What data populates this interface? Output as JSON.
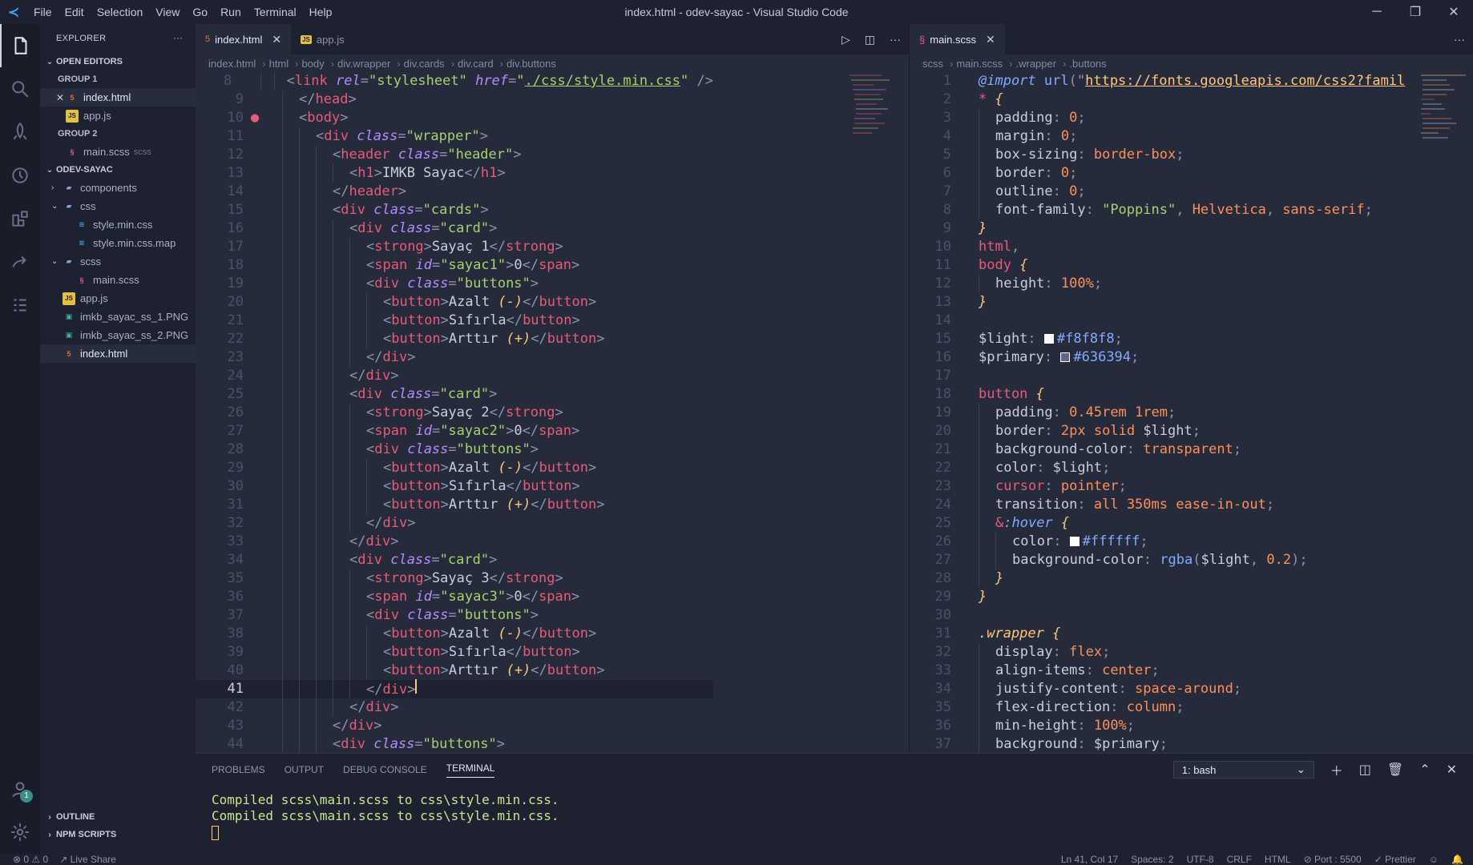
{
  "titlebar": {
    "title": "index.html - odev-sayac - Visual Studio Code",
    "menu": [
      "File",
      "Edit",
      "Selection",
      "View",
      "Go",
      "Run",
      "Terminal",
      "Help"
    ]
  },
  "activity": {
    "icons": [
      "files-icon",
      "search-icon",
      "rocket-icon",
      "history-icon",
      "extensions-icon",
      "live-share-icon",
      "list-icon"
    ],
    "account_badge": "1"
  },
  "sidebar": {
    "title": "EXPLORER",
    "open_editors": "OPEN EDITORS",
    "group1": "GROUP 1",
    "g1_files": [
      {
        "name": "index.html",
        "type": "html"
      },
      {
        "name": "app.js",
        "type": "js"
      }
    ],
    "group2": "GROUP 2",
    "g2_file": {
      "name": "main.scss",
      "sub": "scss"
    },
    "project": "ODEV-SAYAC",
    "tree": [
      {
        "name": "components",
        "type": "folder",
        "depth": 1,
        "open": false
      },
      {
        "name": "css",
        "type": "folder",
        "depth": 1,
        "open": true
      },
      {
        "name": "style.min.css",
        "type": "css",
        "depth": 2
      },
      {
        "name": "style.min.css.map",
        "type": "css",
        "depth": 2
      },
      {
        "name": "scss",
        "type": "folder",
        "depth": 1,
        "open": true
      },
      {
        "name": "main.scss",
        "type": "scss",
        "depth": 2
      },
      {
        "name": "app.js",
        "type": "js",
        "depth": 1
      },
      {
        "name": "imkb_sayac_ss_1.PNG",
        "type": "png",
        "depth": 1
      },
      {
        "name": "imkb_sayac_ss_2.PNG",
        "type": "png",
        "depth": 1
      },
      {
        "name": "index.html",
        "type": "html",
        "depth": 1
      }
    ],
    "outline": "OUTLINE",
    "npm": "NPM SCRIPTS"
  },
  "editorL": {
    "tabs": [
      {
        "label": "index.html",
        "type": "html",
        "active": true
      },
      {
        "label": "app.js",
        "type": "js",
        "active": false
      }
    ],
    "crumbs": [
      "index.html",
      "html",
      "body",
      "div.wrapper",
      "div.cards",
      "div.card",
      "div.buttons"
    ]
  },
  "editorR": {
    "tabs": [
      {
        "label": "main.scss",
        "type": "scss",
        "active": true
      }
    ],
    "crumbs": [
      "scss",
      "main.scss",
      ".wrapper",
      ".buttons"
    ]
  },
  "panel": {
    "tabs": [
      "PROBLEMS",
      "OUTPUT",
      "DEBUG CONSOLE",
      "TERMINAL"
    ],
    "active": "TERMINAL",
    "shell": "1: bash",
    "lines": [
      "Compiled scss\\main.scss to css\\style.min.css.",
      "Compiled scss\\main.scss to css\\style.min.css."
    ]
  },
  "status": {
    "errors": "0",
    "warnings": "0",
    "liveshare": "Live Share",
    "pos": "Ln 41, Col 17",
    "spaces": "Spaces: 2",
    "enc": "UTF-8",
    "eol": "CRLF",
    "lang": "HTML",
    "port": "Port : 5500",
    "fmt": "Prettier"
  },
  "colors": {
    "light": "#f8f8f8",
    "primary": "#636394",
    "white": "#ffffff"
  }
}
